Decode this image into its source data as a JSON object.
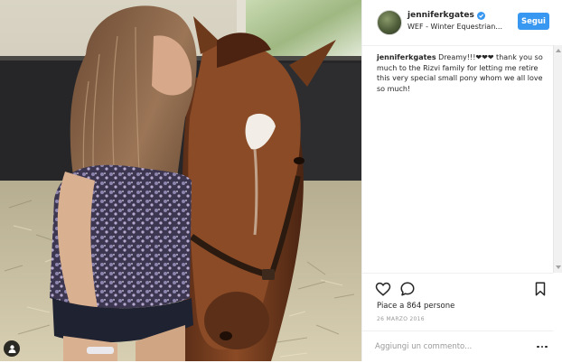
{
  "header": {
    "username": "jenniferkgates",
    "location": "WEF - Winter Equestrian...",
    "follow_label": "Segui"
  },
  "caption": {
    "username": "jenniferkgates",
    "text": "Dreamy!!!❤❤❤ thank you so much to the Rizvi family for letting me retire this very special small pony whom we all love so much!"
  },
  "actions": {
    "likes": "Piace a 864 persone",
    "date": "26 MARZO 2016"
  },
  "comment_box": {
    "placeholder": "Aggiungi un commento..."
  },
  "icons": {
    "like": "heart-icon",
    "comment": "speech-bubble-icon",
    "save": "bookmark-icon",
    "more": "ellipsis-icon",
    "verified": "verified-badge-icon",
    "usertag": "person-tag-icon"
  },
  "colors": {
    "accent": "#3897f0",
    "text": "#262626",
    "muted": "#999999",
    "border": "#efefef"
  }
}
